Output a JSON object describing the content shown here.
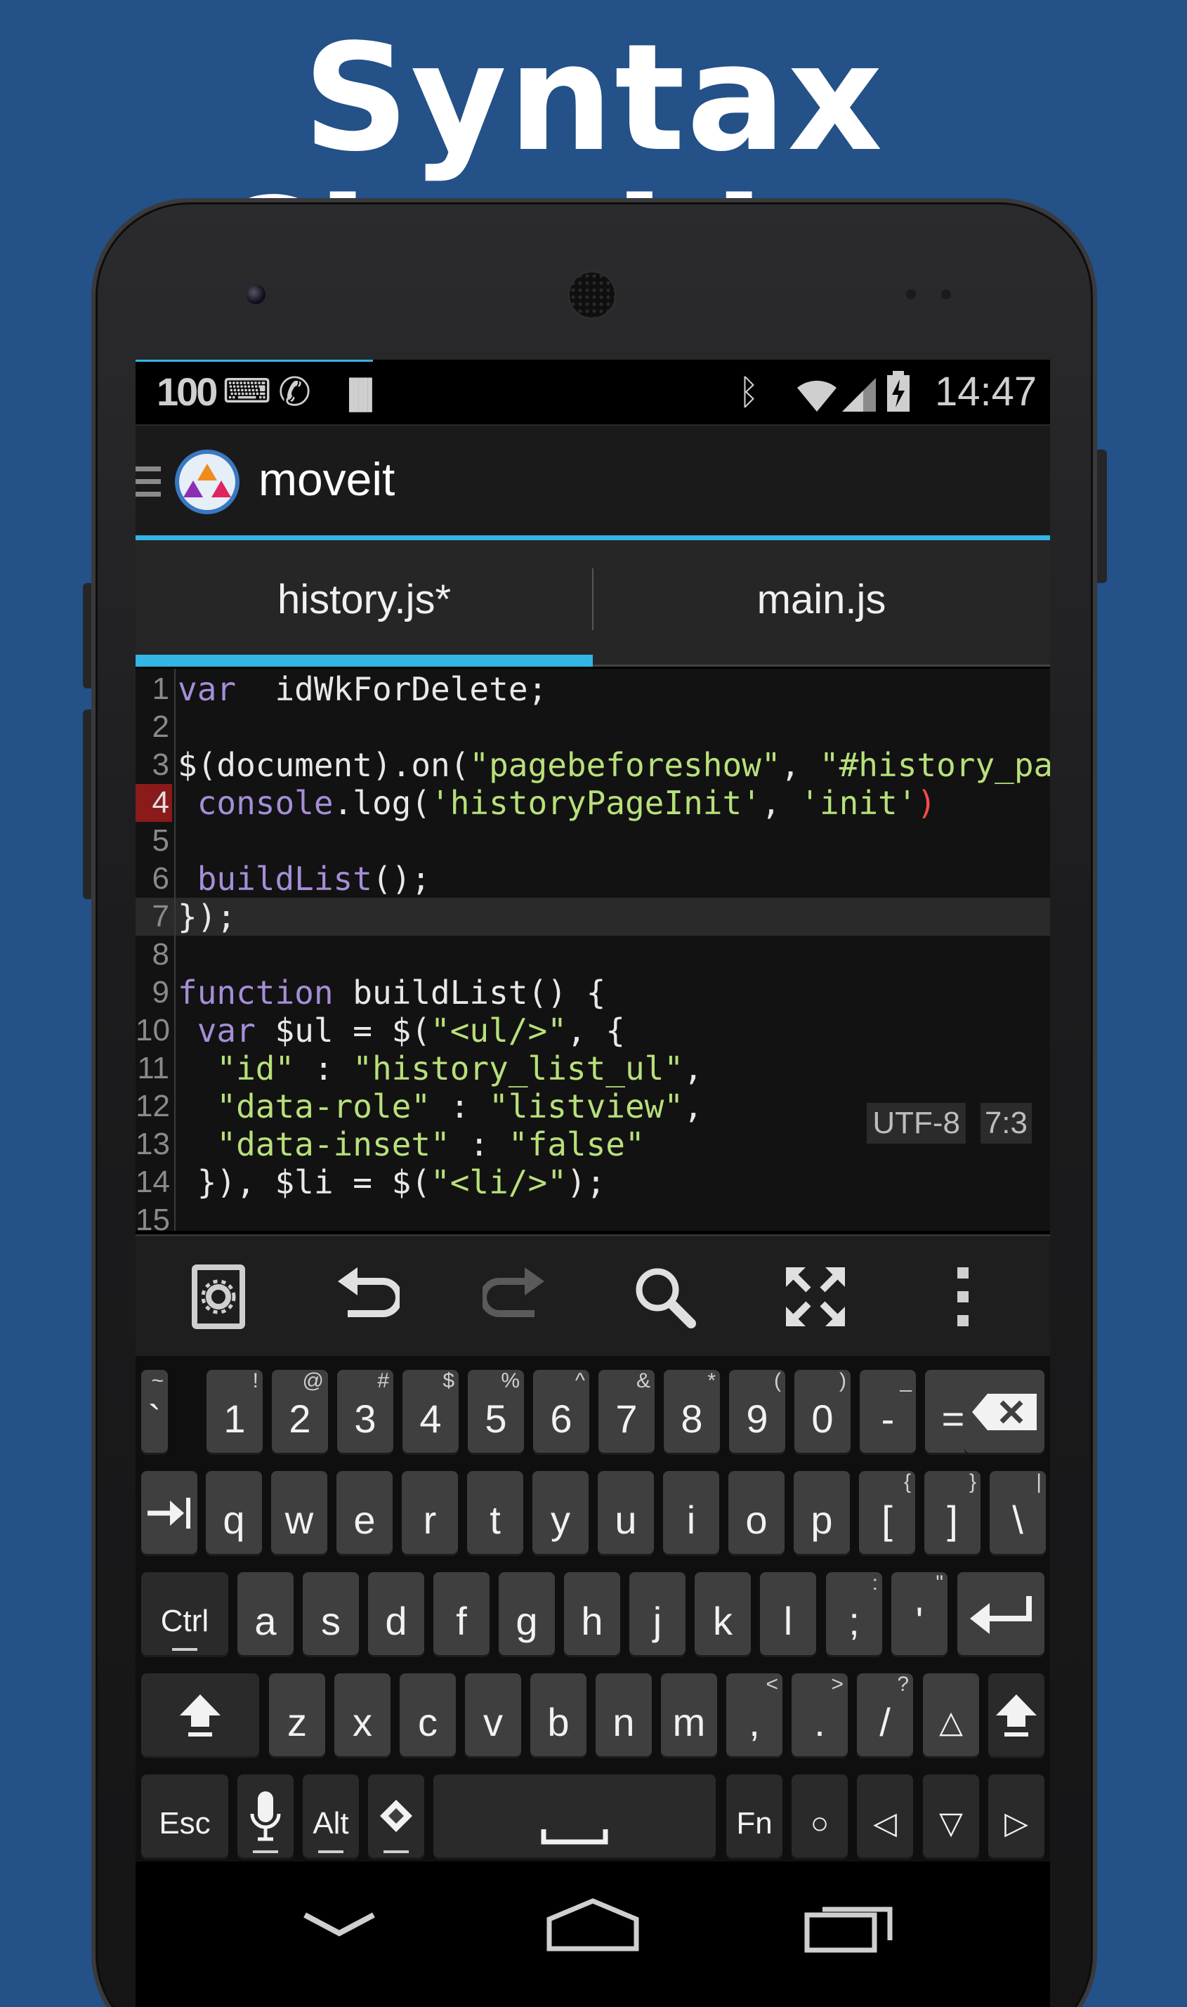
{
  "promo": {
    "title": "Syntax Checking"
  },
  "status_bar": {
    "battery_level": "100",
    "time": "14:47",
    "icons": [
      "keyboard-icon",
      "phone-icon",
      "barcode-icon",
      "bluetooth-icon",
      "wifi-icon",
      "signal-icon",
      "battery-charging-icon"
    ]
  },
  "action_bar": {
    "app_title": "moveit",
    "icons": [
      "drawer-icon",
      "app-logo-icon"
    ]
  },
  "tabs": [
    {
      "label": "history.js*",
      "active": true
    },
    {
      "label": "main.js",
      "active": false
    }
  ],
  "editor": {
    "encoding": "UTF-8",
    "cursor_position": "7:3",
    "error_line": 4,
    "current_line": 7,
    "lines": [
      {
        "n": "1",
        "parts": [
          [
            "kw",
            "var"
          ],
          [
            "",
            "  idWkForDelete;"
          ]
        ]
      },
      {
        "n": "2",
        "parts": []
      },
      {
        "n": "3",
        "parts": [
          [
            "",
            "$(document).on("
          ],
          [
            "str",
            "\"pagebeforeshow\""
          ],
          [
            "",
            ", "
          ],
          [
            "str",
            "\"#history_pa"
          ]
        ]
      },
      {
        "n": "4",
        "parts": [
          [
            "",
            ""
          ],
          [
            "kw",
            " console"
          ],
          [
            "",
            ".log("
          ],
          [
            "str",
            "'historyPageInit'"
          ],
          [
            "",
            ", "
          ],
          [
            "str",
            "'init'"
          ],
          [
            "err",
            ")"
          ]
        ]
      },
      {
        "n": "5",
        "parts": []
      },
      {
        "n": "6",
        "parts": [
          [
            "kw",
            " buildList"
          ],
          [
            "",
            "();"
          ]
        ]
      },
      {
        "n": "7",
        "parts": [
          [
            "",
            "});"
          ]
        ]
      },
      {
        "n": "8",
        "parts": []
      },
      {
        "n": "9",
        "parts": [
          [
            "kw",
            "function"
          ],
          [
            "",
            " buildList() {"
          ]
        ]
      },
      {
        "n": "10",
        "parts": [
          [
            "kw",
            " var"
          ],
          [
            "",
            " $ul = $("
          ],
          [
            "str",
            "\"<ul/>\""
          ],
          [
            "",
            ", {"
          ]
        ]
      },
      {
        "n": "11",
        "parts": [
          [
            "str",
            "  \"id\""
          ],
          [
            "",
            " : "
          ],
          [
            "str",
            "\"history_list_ul\""
          ],
          [
            "",
            ","
          ]
        ]
      },
      {
        "n": "12",
        "parts": [
          [
            "str",
            "  \"data-role\""
          ],
          [
            "",
            " : "
          ],
          [
            "str",
            "\"listview\""
          ],
          [
            "",
            ","
          ]
        ]
      },
      {
        "n": "13",
        "parts": [
          [
            "str",
            "  \"data-inset\""
          ],
          [
            "",
            " : "
          ],
          [
            "str",
            "\"false\""
          ]
        ]
      },
      {
        "n": "14",
        "parts": [
          [
            "",
            " }), $li = $("
          ],
          [
            "str",
            "\"<li/>\""
          ],
          [
            "",
            ");"
          ]
        ]
      },
      {
        "n": "15",
        "parts": []
      }
    ]
  },
  "toolbar": {
    "items": [
      "settings-icon",
      "undo-icon",
      "redo-icon",
      "search-icon",
      "fullscreen-icon",
      "overflow-menu-icon"
    ]
  },
  "keyboard": {
    "row1": [
      {
        "main": "`",
        "sub": "~"
      },
      {
        "main": "1",
        "sub": "!"
      },
      {
        "main": "2",
        "sub": "@"
      },
      {
        "main": "3",
        "sub": "#"
      },
      {
        "main": "4",
        "sub": "$"
      },
      {
        "main": "5",
        "sub": "%"
      },
      {
        "main": "6",
        "sub": "^"
      },
      {
        "main": "7",
        "sub": "&"
      },
      {
        "main": "8",
        "sub": "*"
      },
      {
        "main": "9",
        "sub": "("
      },
      {
        "main": "0",
        "sub": ")"
      },
      {
        "main": "-",
        "sub": "_"
      },
      {
        "main": "=",
        "sub": "+"
      }
    ],
    "row2": [
      "q",
      "w",
      "e",
      "r",
      "t",
      "y",
      "u",
      "i",
      "o",
      "p"
    ],
    "row2_extra": [
      {
        "main": "[",
        "sub": "{"
      },
      {
        "main": "]",
        "sub": "}"
      },
      {
        "main": "\\",
        "sub": "|"
      }
    ],
    "row3": [
      "a",
      "s",
      "d",
      "f",
      "g",
      "h",
      "j",
      "k",
      "l"
    ],
    "row3_extra": [
      {
        "main": ";",
        "sub": ":"
      },
      {
        "main": "'",
        "sub": "\""
      }
    ],
    "row4": [
      "z",
      "x",
      "c",
      "v",
      "b",
      "n",
      "m"
    ],
    "row4_extra": [
      {
        "main": ",",
        "sub": "<"
      },
      {
        "main": ".",
        "sub": ">"
      },
      {
        "main": "/",
        "sub": "?"
      }
    ],
    "ctrl": "Ctrl",
    "esc": "Esc",
    "alt": "Alt",
    "fn": "Fn",
    "arrows": [
      "◁",
      "▽",
      "▷"
    ],
    "circle": "○",
    "up": "△"
  },
  "nav_bar": {
    "icons": [
      "back-icon",
      "home-icon",
      "recents-icon"
    ]
  }
}
